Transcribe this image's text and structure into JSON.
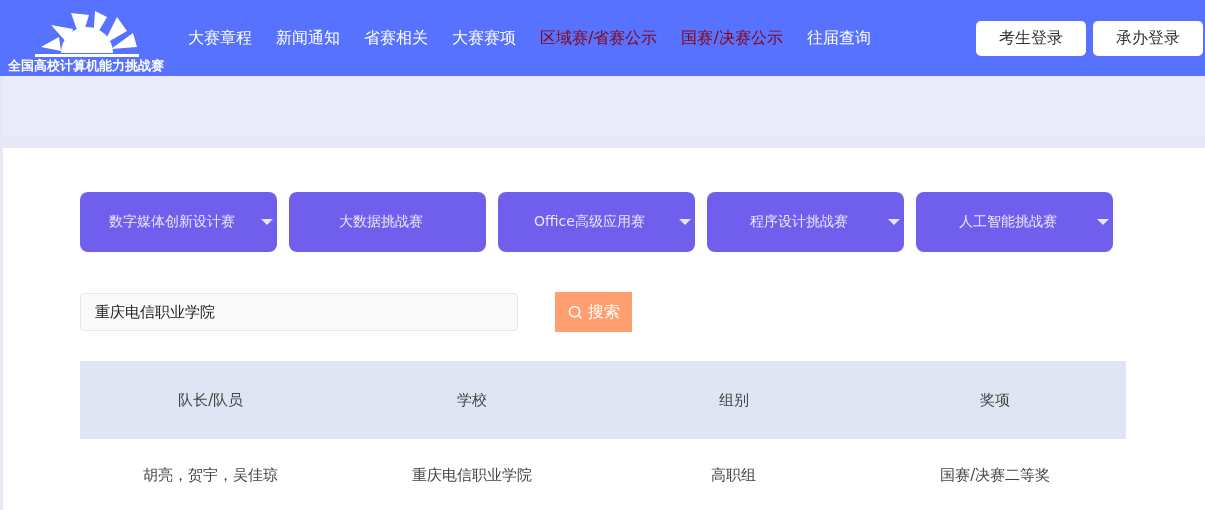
{
  "header": {
    "logo_text": "全国高校计算机能力挑战赛",
    "nav": [
      {
        "label": "大赛章程",
        "highlighted": false
      },
      {
        "label": "新闻通知",
        "highlighted": false
      },
      {
        "label": "省赛相关",
        "highlighted": false
      },
      {
        "label": "大赛赛项",
        "highlighted": false
      },
      {
        "label": "区域赛/省赛公示",
        "highlighted": true
      },
      {
        "label": "国赛/决赛公示",
        "highlighted": true
      },
      {
        "label": "往届查询",
        "highlighted": false
      }
    ],
    "buttons": [
      "考生登录",
      "承办登录"
    ]
  },
  "categories": [
    {
      "label": "数字媒体创新设计赛",
      "dropdown": true
    },
    {
      "label": "大数据挑战赛",
      "dropdown": false
    },
    {
      "label": "Office高级应用赛",
      "dropdown": true
    },
    {
      "label": "程序设计挑战赛",
      "dropdown": true
    },
    {
      "label": "人工智能挑战赛",
      "dropdown": true
    }
  ],
  "search": {
    "value": "重庆电信职业学院",
    "button": "搜索"
  },
  "table": {
    "columns": [
      "队长/队员",
      "学校",
      "组别",
      "奖项"
    ],
    "rows": [
      [
        "胡亮，贺宇，吴佳琼",
        "重庆电信职业学院",
        "高职组",
        "国赛/决赛二等奖"
      ]
    ]
  }
}
